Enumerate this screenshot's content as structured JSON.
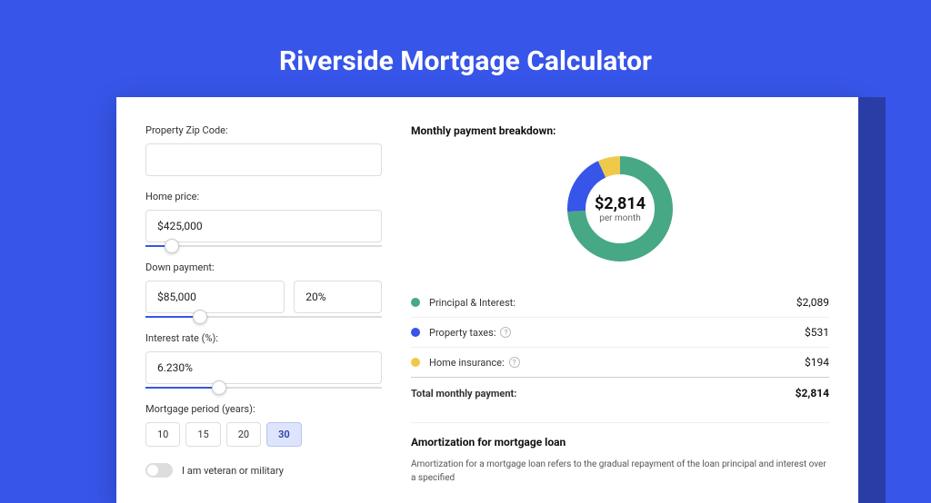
{
  "title": "Riverside Mortgage Calculator",
  "form": {
    "zip": {
      "label": "Property Zip Code:",
      "value": ""
    },
    "price": {
      "label": "Home price:",
      "value": "$425,000",
      "slider": 8
    },
    "down": {
      "label": "Down payment:",
      "amount": "$85,000",
      "percent": "20%",
      "slider": 20
    },
    "rate": {
      "label": "Interest rate (%):",
      "value": "6.230%",
      "slider": 28
    },
    "period": {
      "label": "Mortgage period (years):",
      "options": [
        "10",
        "15",
        "20",
        "30"
      ],
      "active": "30"
    },
    "veteran": {
      "label": "I am veteran or military"
    }
  },
  "breakdown": {
    "title": "Monthly payment breakdown:",
    "center": {
      "amount": "$2,814",
      "sub": "per month"
    },
    "items": [
      {
        "label": "Principal & Interest:",
        "value": "$2,089",
        "color": "#47a886",
        "pct": 74,
        "help": false
      },
      {
        "label": "Property taxes:",
        "value": "$531",
        "color": "#3755e8",
        "pct": 19,
        "help": true
      },
      {
        "label": "Home insurance:",
        "value": "$194",
        "color": "#f0c94b",
        "pct": 7,
        "help": true
      }
    ],
    "total": {
      "label": "Total monthly payment:",
      "value": "$2,814"
    }
  },
  "amort": {
    "title": "Amortization for mortgage loan",
    "text": "Amortization for a mortgage loan refers to the gradual repayment of the loan principal and interest over a specified"
  },
  "chart_data": {
    "type": "pie",
    "title": "Monthly payment breakdown",
    "series": [
      {
        "name": "Principal & Interest",
        "value": 2089,
        "color": "#47a886"
      },
      {
        "name": "Property taxes",
        "value": 531,
        "color": "#3755e8"
      },
      {
        "name": "Home insurance",
        "value": 194,
        "color": "#f0c94b"
      }
    ],
    "total": 2814,
    "unit": "USD per month"
  }
}
